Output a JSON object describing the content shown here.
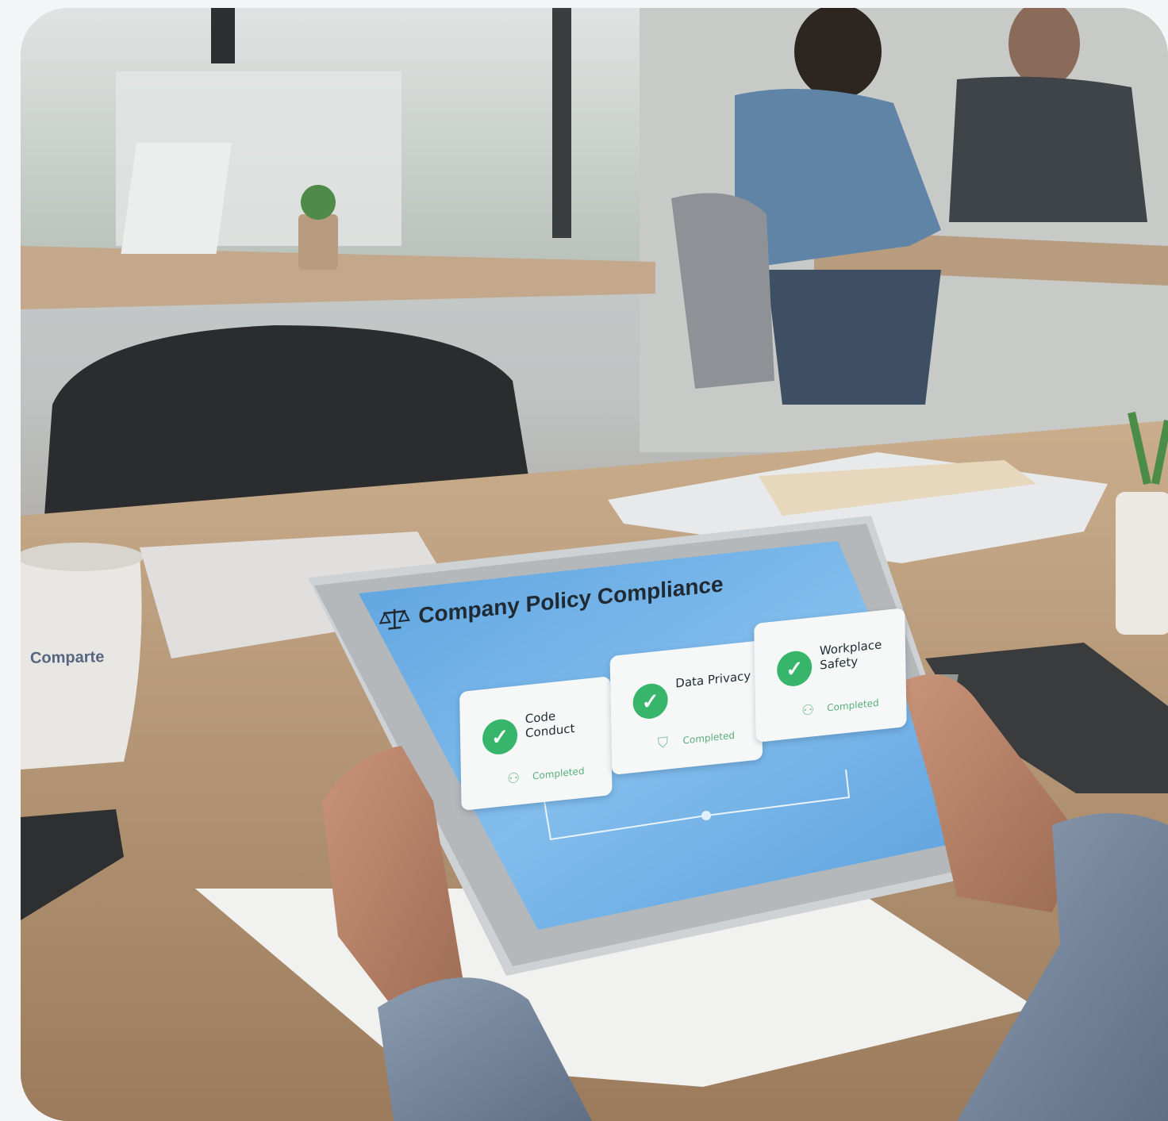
{
  "screen": {
    "title": "Company Policy Compliance",
    "title_icon": "scale-icon",
    "cards": [
      {
        "name": "Code Conduct",
        "status": "Completed",
        "icon": "check-icon",
        "status_icon": "user-icon"
      },
      {
        "name": "Data Privacy",
        "status": "Completed",
        "icon": "shield-check-icon",
        "status_icon": "shield-icon"
      },
      {
        "name": "Workplace Safety",
        "status": "Completed",
        "icon": "check-icon",
        "status_icon": "user-icon"
      }
    ],
    "colors": {
      "screen_bg": "#6fb0e6",
      "check_green": "#36b56b",
      "card_bg": "#f6f8f8"
    }
  },
  "mug": {
    "label": "Comparte"
  }
}
